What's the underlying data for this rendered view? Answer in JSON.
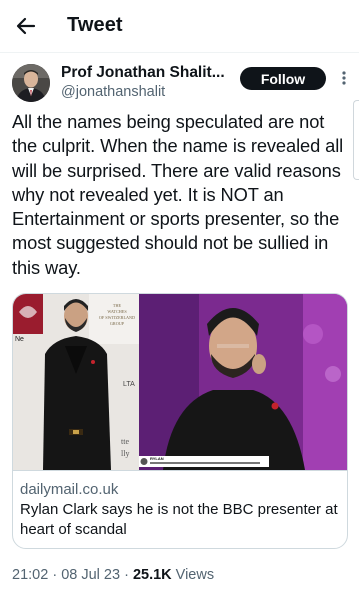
{
  "header": {
    "title": "Tweet",
    "back_icon": "arrow-left-icon"
  },
  "author": {
    "display_name": "Prof Jonathan Shalit...",
    "handle": "@jonathanshalit",
    "follow_label": "Follow",
    "more_icon": "more-vertical-icon"
  },
  "tweet": {
    "text": "All the names being speculated are not the culprit. When the name is revealed all will be surprised. There are valid reasons why not revealed yet. It is NOT an Entertainment or sports presenter, so the most suggested should not be sullied in this way."
  },
  "card": {
    "domain": "dailymail.co.uk",
    "title": "Rylan Clark says he is not the BBC presenter at heart of scandal",
    "left_photo_sign_lines": [
      "THE",
      "WATCHES",
      "OF SWITZERLAND",
      "GROUP"
    ],
    "left_photo_sign_fragments": [
      "Ne",
      "LTA",
      "tte",
      "lly"
    ],
    "right_photo_overlay_label": "RYLAN"
  },
  "meta": {
    "time": "21:02",
    "date": "08 Jul 23",
    "views_count": "25.1K",
    "views_label": "Views"
  },
  "colors": {
    "text_primary": "#0f1419",
    "text_secondary": "#536471",
    "border": "#cfd9de",
    "follow_bg": "#0f1419"
  }
}
